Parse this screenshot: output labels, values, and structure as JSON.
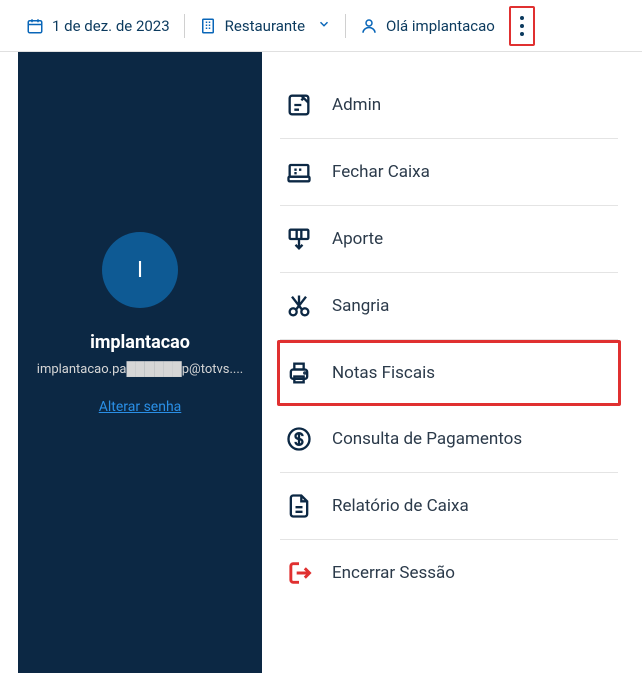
{
  "topbar": {
    "date_label": "1 de dez. de 2023",
    "location_label": "Restaurante",
    "greeting": "Olá implantacao"
  },
  "sidebar": {
    "avatar_initial": "I",
    "username": "implantacao",
    "email": "implantacao.pa██████p@totvs....",
    "change_password_label": "Alterar senha"
  },
  "menu": {
    "items": [
      {
        "label": "Admin"
      },
      {
        "label": "Fechar Caixa"
      },
      {
        "label": "Aporte"
      },
      {
        "label": "Sangria"
      },
      {
        "label": "Notas Fiscais"
      },
      {
        "label": "Consulta de Pagamentos"
      },
      {
        "label": "Relatório de Caixa"
      },
      {
        "label": "Encerrar Sessão"
      }
    ]
  },
  "highlights": {
    "kebab": true,
    "menu_index": 4
  }
}
